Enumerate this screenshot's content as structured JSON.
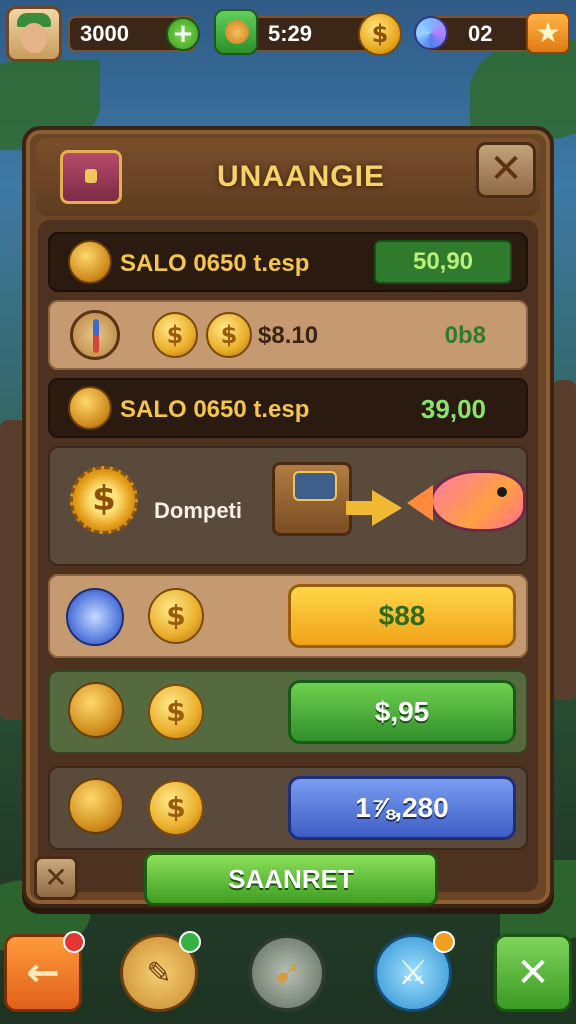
{
  "hud": {
    "gold_amount": "3000",
    "timer": "5:29",
    "gems": "02",
    "icons": [
      "avatar",
      "plus-icon",
      "timer-icon",
      "gold-coin-icon",
      "gem-icon",
      "star-icon"
    ]
  },
  "panel": {
    "title": "UNAANGIE",
    "close_glyph": "✕",
    "rows": [
      {
        "label": "SALO 0650 t.esp",
        "value": "50,90",
        "style": "dark"
      },
      {
        "price": "$8.10",
        "value": "0b8",
        "style": "tan"
      },
      {
        "label": "SALO 0650 t.esp",
        "value": "39,00",
        "style": "dark"
      }
    ],
    "exchange_label": "Dompeti",
    "offers": [
      {
        "price": "$88",
        "color": "yellow"
      },
      {
        "price": "$,95",
        "color": "green"
      },
      {
        "price": "1⅞,280",
        "color": "blue"
      }
    ],
    "confirm_label": "SAANRET",
    "corner_glyph": "✕"
  },
  "bottom_nav": {
    "back_glyph": "←",
    "map_glyph": "✎",
    "compass_glyph": "➹",
    "sword_glyph": "⚔",
    "close_glyph": "✕"
  },
  "colors": {
    "panel_wood": "#6b4526",
    "title_gold": "#f6d36a",
    "btn_yellow": "#ffd64a",
    "btn_green": "#2f8f2a",
    "btn_blue": "#3e5ec5"
  }
}
